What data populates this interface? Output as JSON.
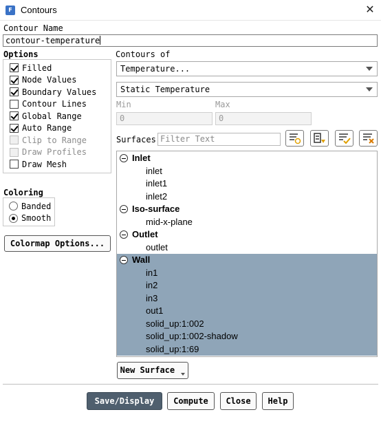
{
  "window": {
    "title": "Contours",
    "app_icon_letter": "F"
  },
  "contour_name": {
    "label": "Contour Name",
    "value": "contour-temperature"
  },
  "options": {
    "label": "Options",
    "items": [
      {
        "label": "Filled",
        "checked": true,
        "disabled": false
      },
      {
        "label": "Node Values",
        "checked": true,
        "disabled": false
      },
      {
        "label": "Boundary Values",
        "checked": true,
        "disabled": false
      },
      {
        "label": "Contour Lines",
        "checked": false,
        "disabled": false
      },
      {
        "label": "Global Range",
        "checked": true,
        "disabled": false
      },
      {
        "label": "Auto Range",
        "checked": true,
        "disabled": false
      },
      {
        "label": "Clip to Range",
        "checked": false,
        "disabled": true
      },
      {
        "label": "Draw Profiles",
        "checked": false,
        "disabled": true
      },
      {
        "label": "Draw Mesh",
        "checked": false,
        "disabled": false
      }
    ]
  },
  "coloring": {
    "label": "Coloring",
    "options": [
      {
        "label": "Banded",
        "selected": false
      },
      {
        "label": "Smooth",
        "selected": true
      }
    ]
  },
  "colormap_button": "Colormap Options...",
  "contours_of": {
    "label": "Contours of",
    "primary": "Temperature...",
    "secondary": "Static Temperature"
  },
  "range": {
    "min_label": "Min",
    "min_value": "0",
    "max_label": "Max",
    "max_value": "0"
  },
  "surfaces": {
    "label": "Surfaces",
    "filter_placeholder": "Filter Text",
    "tree": [
      {
        "name": "Inlet",
        "expanded": true,
        "selected": false,
        "children": [
          "inlet",
          "inlet1",
          "inlet2"
        ]
      },
      {
        "name": "Iso-surface",
        "expanded": true,
        "selected": false,
        "children": [
          "mid-x-plane"
        ]
      },
      {
        "name": "Outlet",
        "expanded": true,
        "selected": false,
        "children": [
          "outlet"
        ]
      },
      {
        "name": "Wall",
        "expanded": true,
        "selected": true,
        "children": [
          "in1",
          "in2",
          "in3",
          "out1",
          "solid_up:1:002",
          "solid_up:1:002-shadow",
          "solid_up:1:69"
        ]
      }
    ]
  },
  "new_surface_button": "New Surface",
  "footer": {
    "save_display": "Save/Display",
    "compute": "Compute",
    "close": "Close",
    "help": "Help"
  },
  "colors": {
    "selection": "#8fa5b8",
    "primary_button": "#4f5f6e",
    "app_icon": "#3a72c6"
  }
}
